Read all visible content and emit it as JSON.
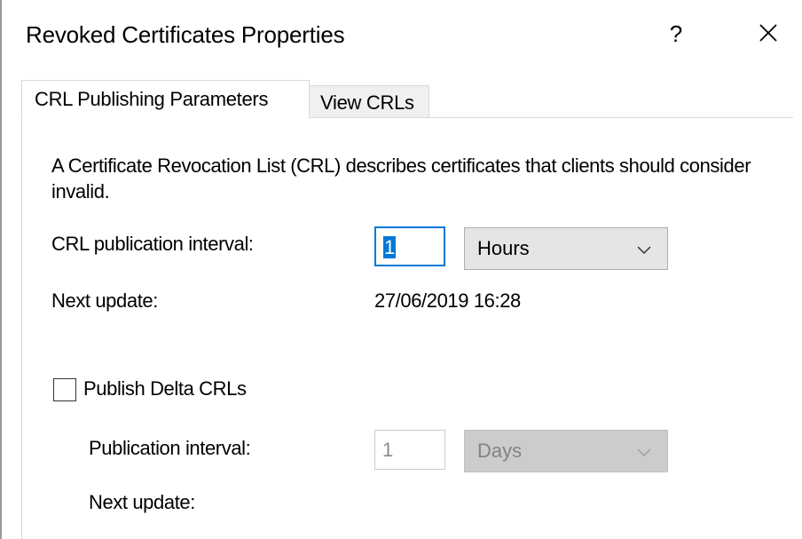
{
  "dialog": {
    "title": "Revoked Certificates Properties",
    "help_label": "?",
    "close_icon": "close-icon"
  },
  "tabs": [
    {
      "label": "CRL Publishing Parameters",
      "selected": true
    },
    {
      "label": "View CRLs",
      "selected": false
    }
  ],
  "description": "A Certificate Revocation List (CRL) describes certificates that clients should consider invalid.",
  "crl": {
    "interval_label": "CRL publication interval:",
    "interval_value": "1",
    "interval_unit": "Hours",
    "next_update_label": "Next update:",
    "next_update_value": "27/06/2019 16:28"
  },
  "delta": {
    "checkbox_label": "Publish Delta CRLs",
    "checked": false,
    "interval_label": "Publication interval:",
    "interval_value": "1",
    "interval_unit": "Days",
    "next_update_label": "Next update:"
  },
  "colors": {
    "focus_accent": "#0078d7",
    "disabled_text": "#8a8a8a",
    "combo_bg": "#e5e5e5"
  }
}
